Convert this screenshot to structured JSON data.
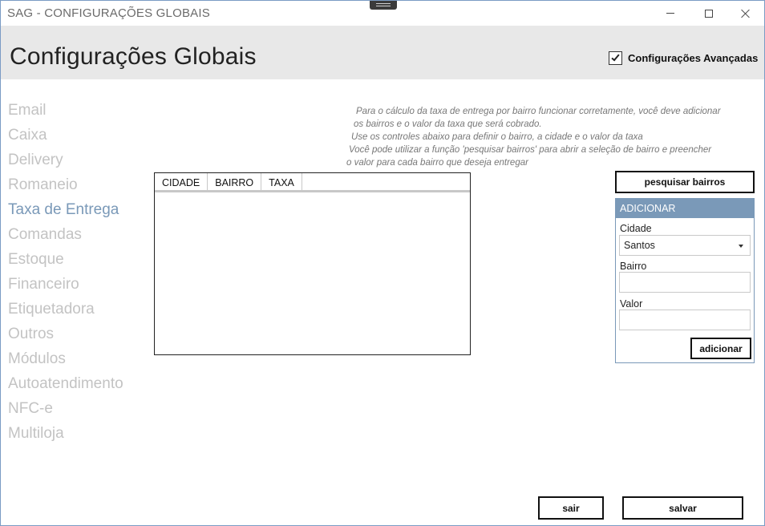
{
  "window": {
    "title": "SAG - CONFIGURAÇÕES GLOBAIS"
  },
  "header": {
    "title": "Configurações Globais",
    "advanced_label": "Configurações Avançadas",
    "advanced_checked": true
  },
  "sidebar": {
    "items": [
      {
        "label": "Email",
        "active": false
      },
      {
        "label": "Caixa",
        "active": false
      },
      {
        "label": "Delivery",
        "active": false
      },
      {
        "label": "Romaneio",
        "active": false
      },
      {
        "label": "Taxa de Entrega",
        "active": true
      },
      {
        "label": "Comandas",
        "active": false
      },
      {
        "label": "Estoque",
        "active": false
      },
      {
        "label": "Financeiro",
        "active": false
      },
      {
        "label": "Etiquetadora",
        "active": false
      },
      {
        "label": "Outros",
        "active": false
      },
      {
        "label": "Módulos",
        "active": false
      },
      {
        "label": "Autoatendimento",
        "active": false
      },
      {
        "label": "NFC-e",
        "active": false
      },
      {
        "label": "Multiloja",
        "active": false
      }
    ]
  },
  "info": {
    "lines": [
      "Para o cálculo da taxa de entrega por bairro funcionar corretamente, você deve adicionar",
      "os bairros e o valor da taxa que será cobrado.",
      "Use os controles abaixo para definir o bairro, a cidade e o valor da taxa",
      "Você pode utilizar a função 'pesquisar bairros' para abrir a seleção de bairro e preencher",
      "o valor para cada bairro que deseja entregar"
    ]
  },
  "grid": {
    "columns": [
      "CIDADE",
      "BAIRRO",
      "TAXA"
    ],
    "rows": []
  },
  "search_button": "pesquisar bairros",
  "add_panel": {
    "title": "ADICIONAR",
    "city_label": "Cidade",
    "city_value": "Santos",
    "neighborhood_label": "Bairro",
    "neighborhood_value": "",
    "value_label": "Valor",
    "value_value": "",
    "add_button": "adicionar"
  },
  "footer": {
    "exit_button": "sair",
    "save_button": "salvar"
  },
  "colors": {
    "accent": "#7a99b8",
    "header_bg": "#e8e8e8",
    "inactive_nav": "#c3c3c3"
  }
}
